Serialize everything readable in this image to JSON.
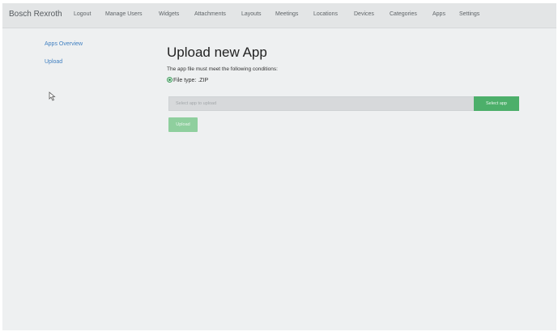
{
  "navbar": {
    "brand": "Bosch Rexroth",
    "items": [
      "Logout",
      "Manage Users",
      "Widgets",
      "Attachments",
      "Layouts",
      "Meetings",
      "Locations",
      "Devices",
      "Categories",
      "Apps",
      "Settings"
    ]
  },
  "sidebar": {
    "items": [
      {
        "label": "Apps Overview"
      },
      {
        "label": "Upload"
      }
    ]
  },
  "main": {
    "title": "Upload new App",
    "conditions_text": "The app file must meet the following conditions:",
    "file_type_text": "File type: .ZIP",
    "file_input_placeholder": "Select app to upload",
    "select_button_label": "Select app",
    "upload_button_label": "Upload"
  },
  "colors": {
    "accent_green": "#4caf6a",
    "disabled_green": "#8fcf9e",
    "link_blue": "#3f7fc1",
    "background": "#eef0f1"
  }
}
